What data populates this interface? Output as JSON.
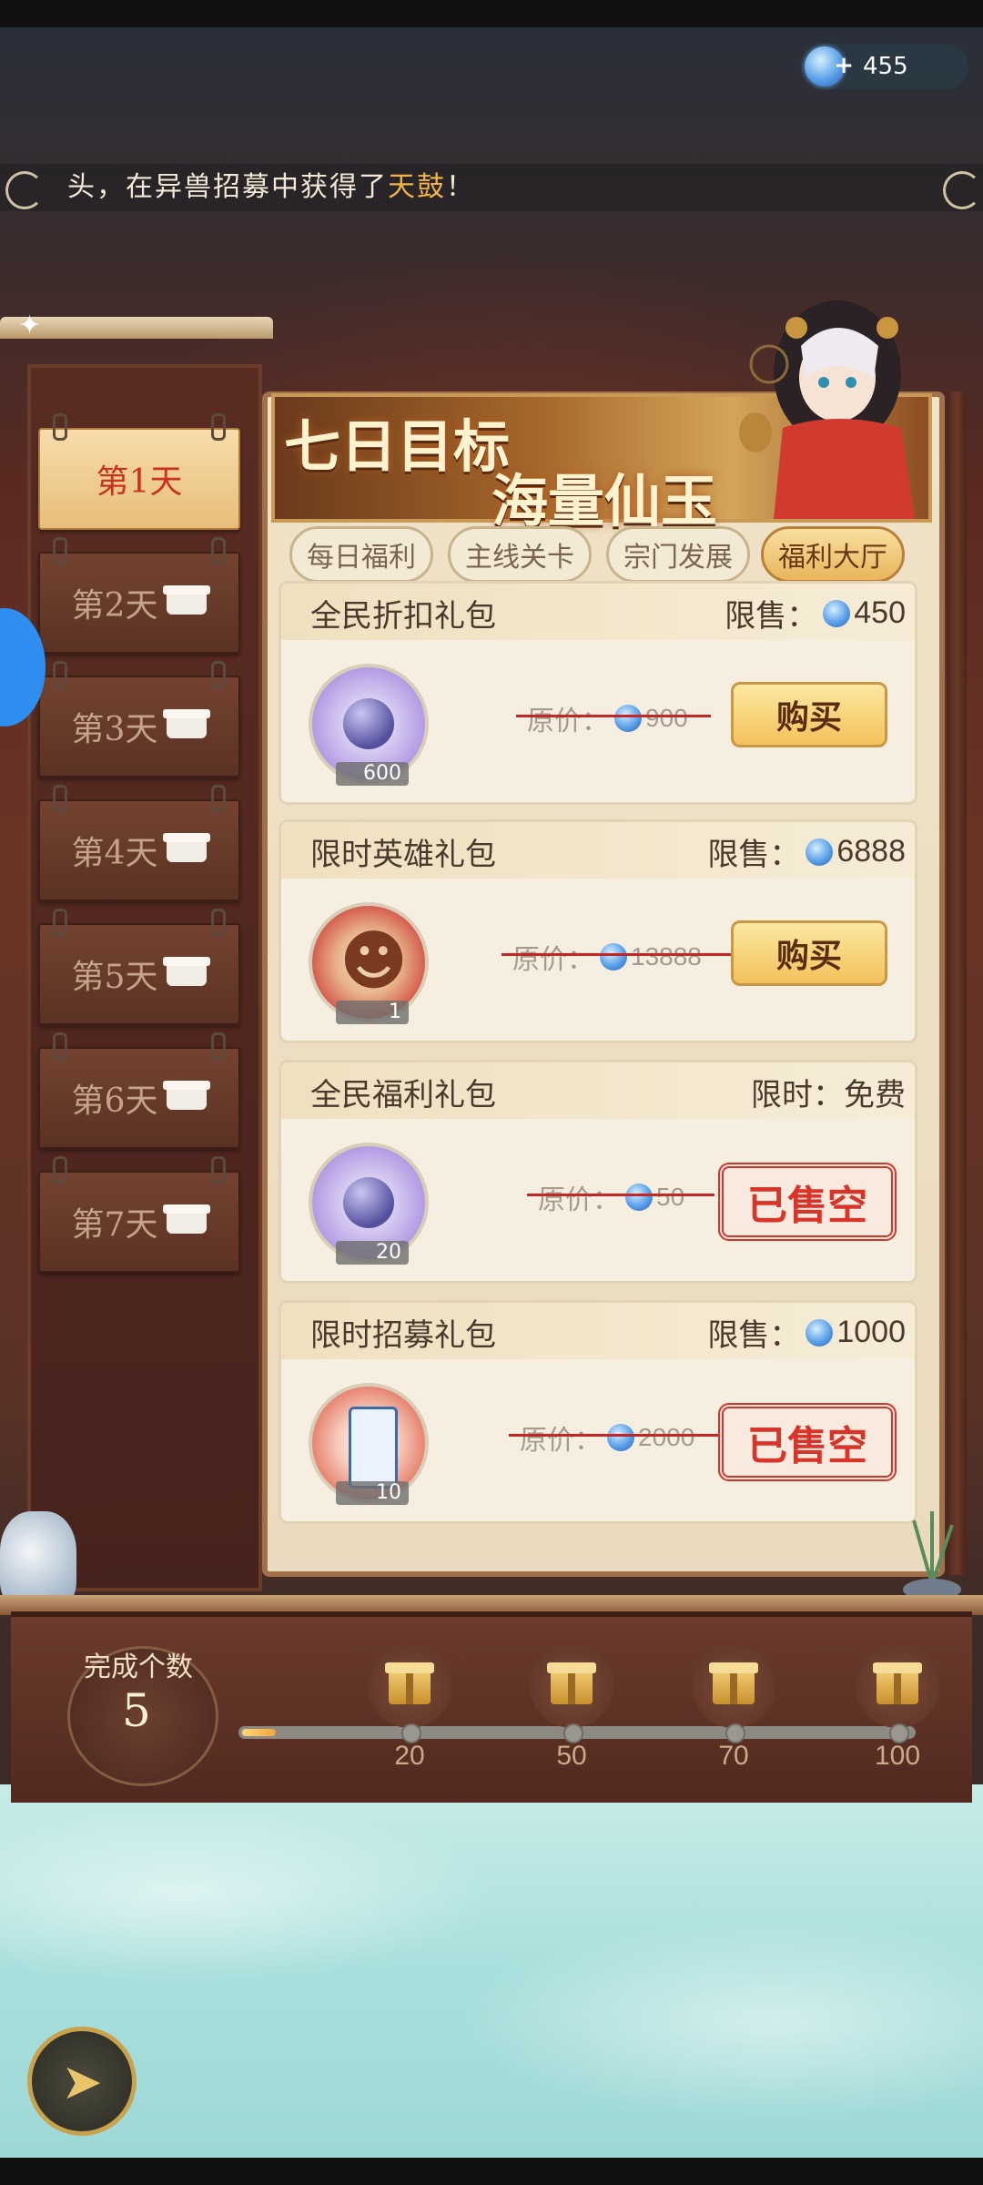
{
  "header": {
    "currency": "455"
  },
  "ticker": {
    "prefix": "头，在异兽招募中获得了",
    "highlight": "天鼓",
    "suffix": "！"
  },
  "banner": {
    "line1": "七日目标",
    "line2": "海量仙玉"
  },
  "days": [
    {
      "label": "第1天",
      "active": true
    },
    {
      "label": "第2天",
      "active": false
    },
    {
      "label": "第3天",
      "active": false
    },
    {
      "label": "第4天",
      "active": false
    },
    {
      "label": "第5天",
      "active": false
    },
    {
      "label": "第6天",
      "active": false
    },
    {
      "label": "第7天",
      "active": false
    }
  ],
  "tabs": [
    {
      "label": "每日福利",
      "active": false
    },
    {
      "label": "主线关卡",
      "active": false
    },
    {
      "label": "宗门发展",
      "active": false
    },
    {
      "label": "福利大厅",
      "active": true
    }
  ],
  "packs": [
    {
      "title": "全民折扣礼包",
      "price_label": "限售：",
      "price": "450",
      "quantity": "600",
      "orig_label": "原价：",
      "orig_price": "900",
      "action": "购买",
      "status": "buy"
    },
    {
      "title": "限时英雄礼包",
      "price_label": "限售：",
      "price": "6888",
      "quantity": "1",
      "orig_label": "原价：",
      "orig_price": "13888",
      "action": "购买",
      "status": "buy"
    },
    {
      "title": "全民福利礼包",
      "price_label": "限时：",
      "price": "免费",
      "quantity": "20",
      "orig_label": "原价：",
      "orig_price": "50",
      "action": "已售空",
      "status": "sold"
    },
    {
      "title": "限时招募礼包",
      "price_label": "限售：",
      "price": "1000",
      "quantity": "10",
      "orig_label": "原价：",
      "orig_price": "2000",
      "action": "已售空",
      "status": "sold"
    }
  ],
  "progress": {
    "label": "完成个数",
    "count": "5",
    "milestones": [
      "20",
      "50",
      "70",
      "100"
    ],
    "fraction": 0.05
  },
  "icons": {
    "currency": "jade-icon",
    "locked_day": "chest-icon",
    "reward": "gift-icon",
    "back": "back-arrow-icon"
  }
}
